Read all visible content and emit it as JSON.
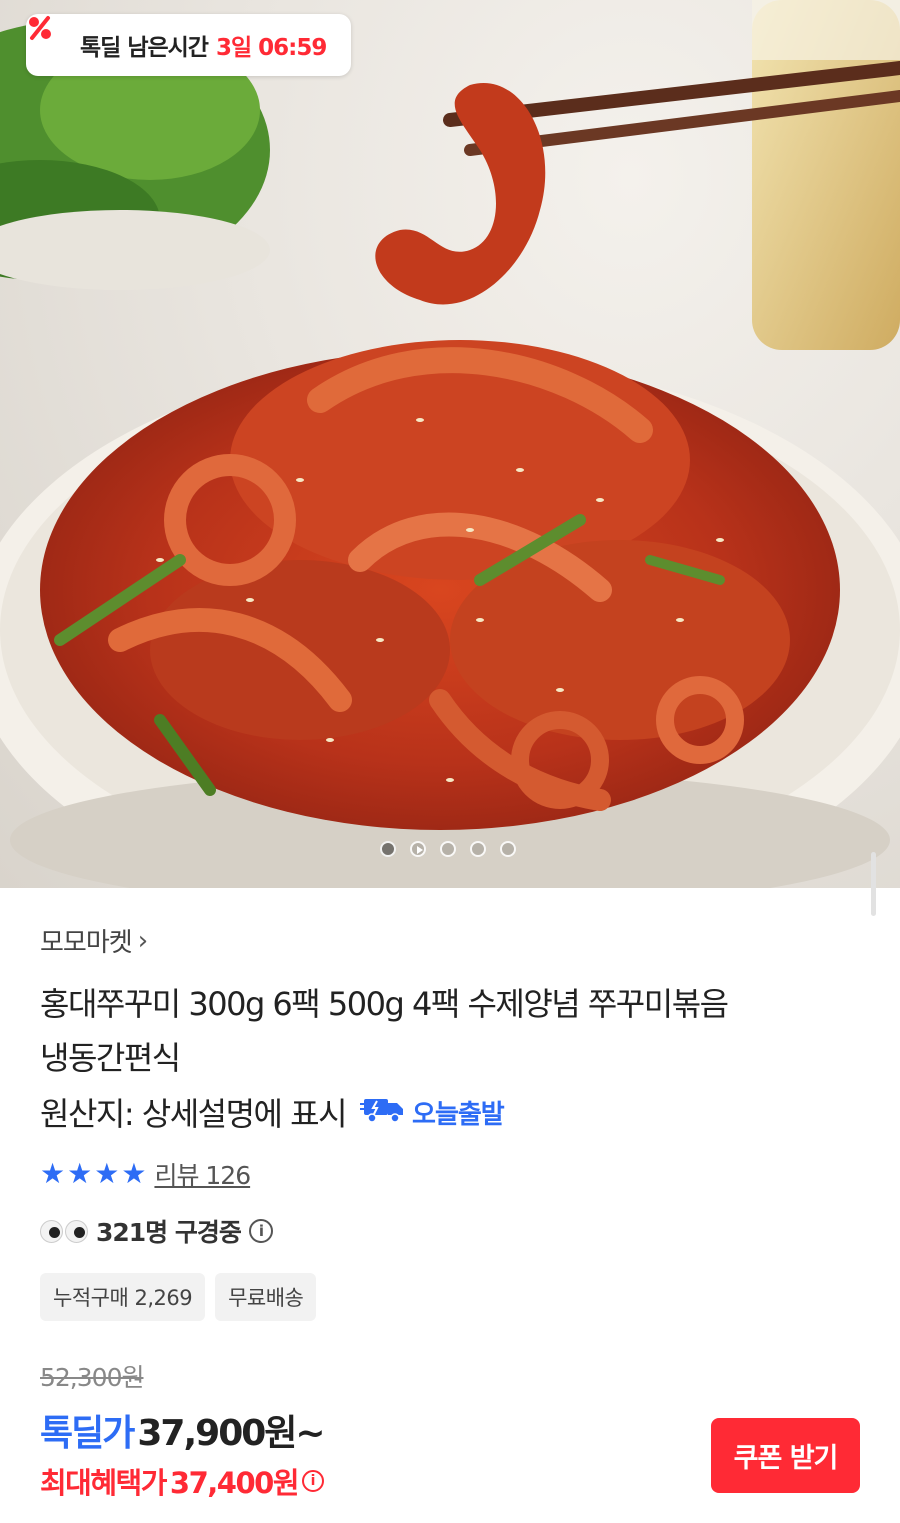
{
  "deal_timer": {
    "label": "톡딜 남은시간",
    "time": "3일 06:59",
    "icon": "percent-icon"
  },
  "gallery": {
    "image": "spicy-stir-fried-webfoot-octopus-photo",
    "dot_count": 5,
    "active_index": 0
  },
  "seller": {
    "name": "모모마켓",
    "chevron": "›"
  },
  "product": {
    "title_line1": "홍대쭈꾸미 300g 6팩 500g 4팩 수제양념 쭈꾸미볶음",
    "title_line2": "냉동간편식",
    "origin": "원산지: 상세설명에 표시",
    "shipping_badge": "오늘출발"
  },
  "rating": {
    "stars": 4,
    "review_label": "리뷰 126"
  },
  "viewers": {
    "text": "321명 구경중",
    "info": "i"
  },
  "tags": [
    "누적구매 2,269",
    "무료배송"
  ],
  "price": {
    "original": "52,300원",
    "deal_label": "톡딜가",
    "deal_price": "37,900원~",
    "best_label": "최대혜택가",
    "best_price": "37,400원",
    "info": "i"
  },
  "coupon_button": "쿠폰 받기",
  "colors": {
    "accent_red": "#ff2a35",
    "accent_blue": "#2d6cf5"
  }
}
